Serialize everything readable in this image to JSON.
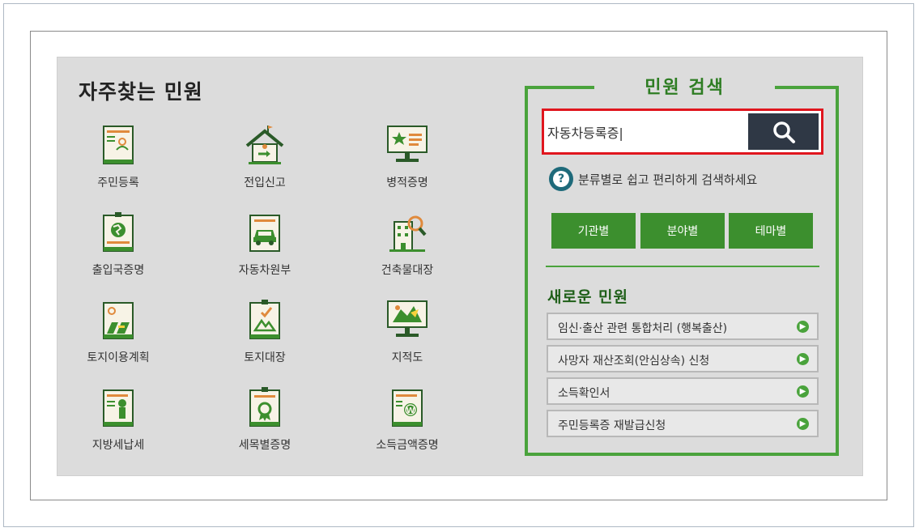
{
  "frequent": {
    "title": "자주찾는 민원",
    "items": [
      {
        "label": "주민등록",
        "icon": "id-card-icon"
      },
      {
        "label": "전입신고",
        "icon": "house-icon"
      },
      {
        "label": "병적증명",
        "icon": "monitor-star-icon"
      },
      {
        "label": "출입국증명",
        "icon": "globe-document-icon"
      },
      {
        "label": "자동차원부",
        "icon": "car-document-icon"
      },
      {
        "label": "건축물대장",
        "icon": "building-search-icon"
      },
      {
        "label": "토지이용계획",
        "icon": "land-plan-icon"
      },
      {
        "label": "토지대장",
        "icon": "land-register-icon"
      },
      {
        "label": "지적도",
        "icon": "map-monitor-icon"
      },
      {
        "label": "지방세납세",
        "icon": "tax-document-icon"
      },
      {
        "label": "세목별증명",
        "icon": "certificate-icon"
      },
      {
        "label": "소득금액증명",
        "icon": "income-certificate-icon"
      }
    ]
  },
  "search": {
    "title": "민원 검색",
    "value": "자동차등록증|",
    "button_icon": "search-icon",
    "help_text": "분류별로 쉽고 편리하게 검색하세요",
    "categories": [
      "기관별",
      "분야별",
      "테마별"
    ]
  },
  "new_services": {
    "title": "새로운 민원",
    "items": [
      "임신·출산 관련 통합처리 (행복출산)",
      "사망자 재산조회(안심상속) 신청",
      "소득확인서",
      "주민등록증 재발급신청"
    ]
  },
  "colors": {
    "accent_green": "#4aa33c",
    "button_green": "#3c8f2e",
    "highlight_red": "#e0161e",
    "search_button": "#2f3845"
  }
}
